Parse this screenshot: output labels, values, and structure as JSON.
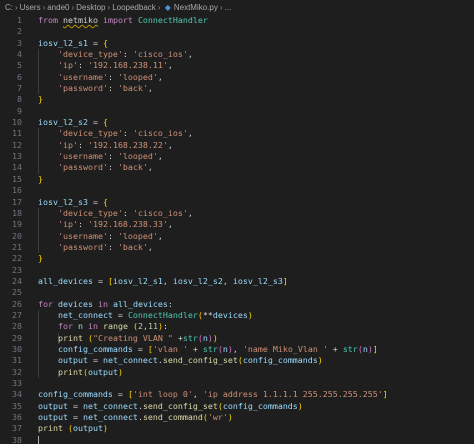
{
  "breadcrumb": {
    "segments": [
      "C:",
      "Users",
      "ande0",
      "Desktop",
      "Loopedback"
    ],
    "file_icon": "python-file-icon",
    "file": "NextMiko.py",
    "trailing": "..."
  },
  "lines": [
    {
      "n": "1",
      "indent": 0,
      "tokens": [
        {
          "t": "kw",
          "v": "from"
        },
        {
          "t": "pl",
          "v": " "
        },
        {
          "t": "pl",
          "v": "netmiko",
          "squig": true
        },
        {
          "t": "pl",
          "v": " "
        },
        {
          "t": "kw",
          "v": "import"
        },
        {
          "t": "pl",
          "v": " "
        },
        {
          "t": "cls",
          "v": "ConnectHandler"
        }
      ]
    },
    {
      "n": "2",
      "indent": 0,
      "tokens": []
    },
    {
      "n": "3",
      "indent": 0,
      "tokens": [
        {
          "t": "var",
          "v": "iosv_l2_s1"
        },
        {
          "t": "pl",
          "v": " = "
        },
        {
          "t": "p1",
          "v": "{"
        }
      ]
    },
    {
      "n": "4",
      "indent": 1,
      "tokens": [
        {
          "t": "pl",
          "v": "    "
        },
        {
          "t": "str",
          "v": "'device_type'"
        },
        {
          "t": "pl",
          "v": ": "
        },
        {
          "t": "str",
          "v": "'cisco_ios'"
        },
        {
          "t": "pl",
          "v": ","
        }
      ]
    },
    {
      "n": "5",
      "indent": 1,
      "tokens": [
        {
          "t": "pl",
          "v": "    "
        },
        {
          "t": "str",
          "v": "'ip'"
        },
        {
          "t": "pl",
          "v": ": "
        },
        {
          "t": "str",
          "v": "'192.168.238.11'"
        },
        {
          "t": "pl",
          "v": ","
        }
      ]
    },
    {
      "n": "6",
      "indent": 1,
      "tokens": [
        {
          "t": "pl",
          "v": "    "
        },
        {
          "t": "str",
          "v": "'username'"
        },
        {
          "t": "pl",
          "v": ": "
        },
        {
          "t": "str",
          "v": "'looped'"
        },
        {
          "t": "pl",
          "v": ","
        }
      ]
    },
    {
      "n": "7",
      "indent": 1,
      "tokens": [
        {
          "t": "pl",
          "v": "    "
        },
        {
          "t": "str",
          "v": "'password'"
        },
        {
          "t": "pl",
          "v": ": "
        },
        {
          "t": "str",
          "v": "'back'"
        },
        {
          "t": "pl",
          "v": ","
        }
      ]
    },
    {
      "n": "8",
      "indent": 0,
      "tokens": [
        {
          "t": "p1",
          "v": "}"
        }
      ]
    },
    {
      "n": "9",
      "indent": 0,
      "tokens": []
    },
    {
      "n": "10",
      "indent": 0,
      "tokens": [
        {
          "t": "var",
          "v": "iosv_l2_s2"
        },
        {
          "t": "pl",
          "v": " = "
        },
        {
          "t": "p1",
          "v": "{"
        }
      ]
    },
    {
      "n": "11",
      "indent": 1,
      "tokens": [
        {
          "t": "pl",
          "v": "    "
        },
        {
          "t": "str",
          "v": "'device_type'"
        },
        {
          "t": "pl",
          "v": ": "
        },
        {
          "t": "str",
          "v": "'cisco_ios'"
        },
        {
          "t": "pl",
          "v": ","
        }
      ]
    },
    {
      "n": "12",
      "indent": 1,
      "tokens": [
        {
          "t": "pl",
          "v": "    "
        },
        {
          "t": "str",
          "v": "'ip'"
        },
        {
          "t": "pl",
          "v": ": "
        },
        {
          "t": "str",
          "v": "'192.168.238.22'"
        },
        {
          "t": "pl",
          "v": ","
        }
      ]
    },
    {
      "n": "13",
      "indent": 1,
      "tokens": [
        {
          "t": "pl",
          "v": "    "
        },
        {
          "t": "str",
          "v": "'username'"
        },
        {
          "t": "pl",
          "v": ": "
        },
        {
          "t": "str",
          "v": "'looped'"
        },
        {
          "t": "pl",
          "v": ","
        }
      ]
    },
    {
      "n": "14",
      "indent": 1,
      "tokens": [
        {
          "t": "pl",
          "v": "    "
        },
        {
          "t": "str",
          "v": "'password'"
        },
        {
          "t": "pl",
          "v": ": "
        },
        {
          "t": "str",
          "v": "'back'"
        },
        {
          "t": "pl",
          "v": ","
        }
      ]
    },
    {
      "n": "15",
      "indent": 0,
      "tokens": [
        {
          "t": "p1",
          "v": "}"
        }
      ]
    },
    {
      "n": "16",
      "indent": 0,
      "tokens": []
    },
    {
      "n": "17",
      "indent": 0,
      "tokens": [
        {
          "t": "var",
          "v": "iosv_l2_s3"
        },
        {
          "t": "pl",
          "v": " = "
        },
        {
          "t": "p1",
          "v": "{"
        }
      ]
    },
    {
      "n": "18",
      "indent": 1,
      "tokens": [
        {
          "t": "pl",
          "v": "    "
        },
        {
          "t": "str",
          "v": "'device_type'"
        },
        {
          "t": "pl",
          "v": ": "
        },
        {
          "t": "str",
          "v": "'cisco_ios'"
        },
        {
          "t": "pl",
          "v": ","
        }
      ]
    },
    {
      "n": "19",
      "indent": 1,
      "tokens": [
        {
          "t": "pl",
          "v": "    "
        },
        {
          "t": "str",
          "v": "'ip'"
        },
        {
          "t": "pl",
          "v": ": "
        },
        {
          "t": "str",
          "v": "'192.168.238.33'"
        },
        {
          "t": "pl",
          "v": ","
        }
      ]
    },
    {
      "n": "20",
      "indent": 1,
      "tokens": [
        {
          "t": "pl",
          "v": "    "
        },
        {
          "t": "str",
          "v": "'username'"
        },
        {
          "t": "pl",
          "v": ": "
        },
        {
          "t": "str",
          "v": "'looped'"
        },
        {
          "t": "pl",
          "v": ","
        }
      ]
    },
    {
      "n": "21",
      "indent": 1,
      "tokens": [
        {
          "t": "pl",
          "v": "    "
        },
        {
          "t": "str",
          "v": "'password'"
        },
        {
          "t": "pl",
          "v": ": "
        },
        {
          "t": "str",
          "v": "'back'"
        },
        {
          "t": "pl",
          "v": ","
        }
      ]
    },
    {
      "n": "22",
      "indent": 0,
      "tokens": [
        {
          "t": "p1",
          "v": "}"
        }
      ]
    },
    {
      "n": "23",
      "indent": 0,
      "tokens": []
    },
    {
      "n": "24",
      "indent": 0,
      "tokens": [
        {
          "t": "var",
          "v": "all_devices"
        },
        {
          "t": "pl",
          "v": " = "
        },
        {
          "t": "p1",
          "v": "["
        },
        {
          "t": "var",
          "v": "iosv_l2_s1"
        },
        {
          "t": "pl",
          "v": ", "
        },
        {
          "t": "var",
          "v": "iosv_l2_s2"
        },
        {
          "t": "pl",
          "v": ", "
        },
        {
          "t": "var",
          "v": "iosv_l2_s3"
        },
        {
          "t": "p1",
          "v": "]"
        }
      ]
    },
    {
      "n": "25",
      "indent": 0,
      "tokens": []
    },
    {
      "n": "26",
      "indent": 0,
      "tokens": [
        {
          "t": "kw",
          "v": "for"
        },
        {
          "t": "pl",
          "v": " "
        },
        {
          "t": "var",
          "v": "devices"
        },
        {
          "t": "pl",
          "v": " "
        },
        {
          "t": "kw",
          "v": "in"
        },
        {
          "t": "pl",
          "v": " "
        },
        {
          "t": "var",
          "v": "all_devices"
        },
        {
          "t": "pl",
          "v": ":"
        }
      ]
    },
    {
      "n": "27",
      "indent": 1,
      "tokens": [
        {
          "t": "pl",
          "v": "    "
        },
        {
          "t": "var",
          "v": "net_connect"
        },
        {
          "t": "pl",
          "v": " = "
        },
        {
          "t": "cls",
          "v": "ConnectHandler"
        },
        {
          "t": "p1",
          "v": "("
        },
        {
          "t": "pl",
          "v": "**"
        },
        {
          "t": "var",
          "v": "devices"
        },
        {
          "t": "p1",
          "v": ")"
        }
      ]
    },
    {
      "n": "28",
      "indent": 1,
      "tokens": [
        {
          "t": "pl",
          "v": "    "
        },
        {
          "t": "kw",
          "v": "for"
        },
        {
          "t": "pl",
          "v": " "
        },
        {
          "t": "var",
          "v": "n"
        },
        {
          "t": "pl",
          "v": " "
        },
        {
          "t": "kw",
          "v": "in"
        },
        {
          "t": "pl",
          "v": " "
        },
        {
          "t": "fn",
          "v": "range"
        },
        {
          "t": "pl",
          "v": " "
        },
        {
          "t": "p1",
          "v": "("
        },
        {
          "t": "num",
          "v": "2"
        },
        {
          "t": "pl",
          "v": ","
        },
        {
          "t": "num",
          "v": "11"
        },
        {
          "t": "p1",
          "v": ")"
        },
        {
          "t": "pl",
          "v": ":"
        }
      ]
    },
    {
      "n": "29",
      "indent": 2,
      "tokens": [
        {
          "t": "pl",
          "v": "    "
        },
        {
          "t": "fn",
          "v": "print"
        },
        {
          "t": "pl",
          "v": " "
        },
        {
          "t": "p1",
          "v": "("
        },
        {
          "t": "str",
          "v": "\"Creating VLAN \""
        },
        {
          "t": "pl",
          "v": " +"
        },
        {
          "t": "cls",
          "v": "str"
        },
        {
          "t": "p2",
          "v": "("
        },
        {
          "t": "var",
          "v": "n"
        },
        {
          "t": "p2",
          "v": ")"
        },
        {
          "t": "p1",
          "v": ")"
        }
      ]
    },
    {
      "n": "30",
      "indent": 1,
      "tokens": [
        {
          "t": "pl",
          "v": "    "
        },
        {
          "t": "var",
          "v": "config_commands"
        },
        {
          "t": "pl",
          "v": " = "
        },
        {
          "t": "p1",
          "v": "["
        },
        {
          "t": "str",
          "v": "'vlan '"
        },
        {
          "t": "pl",
          "v": " + "
        },
        {
          "t": "cls",
          "v": "str"
        },
        {
          "t": "p2",
          "v": "("
        },
        {
          "t": "var",
          "v": "n"
        },
        {
          "t": "p2",
          "v": ")"
        },
        {
          "t": "pl",
          "v": ", "
        },
        {
          "t": "str",
          "v": "'name Miko_Vlan '"
        },
        {
          "t": "pl",
          "v": " + "
        },
        {
          "t": "cls",
          "v": "str"
        },
        {
          "t": "p2",
          "v": "("
        },
        {
          "t": "var",
          "v": "n"
        },
        {
          "t": "p2",
          "v": ")"
        },
        {
          "t": "p1",
          "v": "]"
        }
      ]
    },
    {
      "n": "31",
      "indent": 1,
      "tokens": [
        {
          "t": "pl",
          "v": "    "
        },
        {
          "t": "var",
          "v": "output"
        },
        {
          "t": "pl",
          "v": " = "
        },
        {
          "t": "var",
          "v": "net_connect"
        },
        {
          "t": "pl",
          "v": "."
        },
        {
          "t": "fn",
          "v": "send_config_set"
        },
        {
          "t": "p1",
          "v": "("
        },
        {
          "t": "var",
          "v": "config_commands"
        },
        {
          "t": "p1",
          "v": ")"
        }
      ]
    },
    {
      "n": "32",
      "indent": 1,
      "tokens": [
        {
          "t": "pl",
          "v": "    "
        },
        {
          "t": "fn",
          "v": "print"
        },
        {
          "t": "p1",
          "v": "("
        },
        {
          "t": "var",
          "v": "output"
        },
        {
          "t": "p1",
          "v": ")"
        }
      ]
    },
    {
      "n": "33",
      "indent": 0,
      "tokens": []
    },
    {
      "n": "34",
      "indent": 0,
      "tokens": [
        {
          "t": "var",
          "v": "config_commands"
        },
        {
          "t": "pl",
          "v": " = "
        },
        {
          "t": "p1",
          "v": "["
        },
        {
          "t": "str",
          "v": "'int loop 0'"
        },
        {
          "t": "pl",
          "v": ", "
        },
        {
          "t": "str",
          "v": "'ip address 1.1.1.1 255.255.255.255'"
        },
        {
          "t": "p1",
          "v": "]"
        }
      ]
    },
    {
      "n": "35",
      "indent": 0,
      "tokens": [
        {
          "t": "var",
          "v": "output"
        },
        {
          "t": "pl",
          "v": " = "
        },
        {
          "t": "var",
          "v": "net_connect"
        },
        {
          "t": "pl",
          "v": "."
        },
        {
          "t": "fn",
          "v": "send_config_set"
        },
        {
          "t": "p1",
          "v": "("
        },
        {
          "t": "var",
          "v": "config_commands"
        },
        {
          "t": "p1",
          "v": ")"
        }
      ]
    },
    {
      "n": "36",
      "indent": 0,
      "tokens": [
        {
          "t": "var",
          "v": "output"
        },
        {
          "t": "pl",
          "v": " = "
        },
        {
          "t": "var",
          "v": "net_connect"
        },
        {
          "t": "pl",
          "v": "."
        },
        {
          "t": "fn",
          "v": "send_command"
        },
        {
          "t": "p1",
          "v": "("
        },
        {
          "t": "str",
          "v": "'wr'"
        },
        {
          "t": "p1",
          "v": ")"
        }
      ]
    },
    {
      "n": "37",
      "indent": 0,
      "tokens": [
        {
          "t": "fn",
          "v": "print"
        },
        {
          "t": "pl",
          "v": " "
        },
        {
          "t": "p1",
          "v": "("
        },
        {
          "t": "var",
          "v": "output"
        },
        {
          "t": "p1",
          "v": ")"
        }
      ]
    },
    {
      "n": "38",
      "indent": 0,
      "tokens": [],
      "cursor": true
    }
  ]
}
